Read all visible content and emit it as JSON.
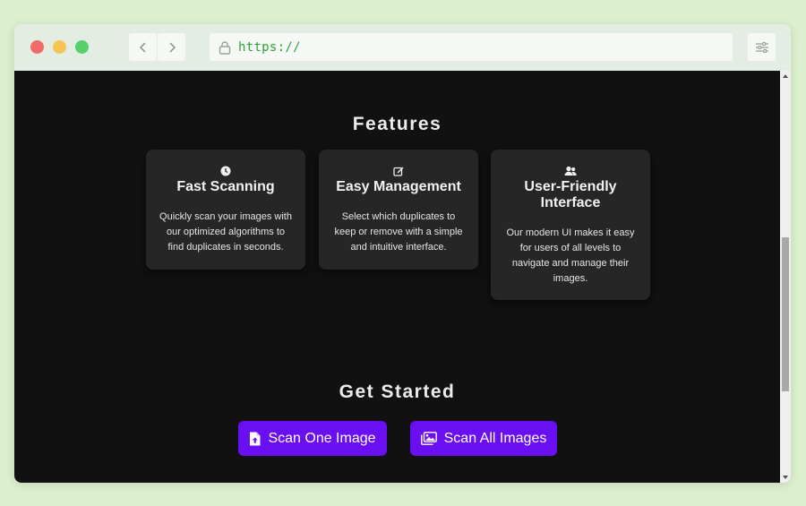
{
  "browser": {
    "url": "https://",
    "icons": [
      "back-chevron-icon",
      "forward-chevron-icon",
      "lock-icon",
      "sliders-icon"
    ]
  },
  "features": {
    "title": "Features",
    "cards": [
      {
        "icon": "clock-icon",
        "title": "Fast Scanning",
        "text": "Quickly scan your images with our optimized algorithms to find duplicates in seconds."
      },
      {
        "icon": "edit-icon",
        "title": "Easy Management",
        "text": "Select which duplicates to keep or remove with a simple and intuitive interface."
      },
      {
        "icon": "users-icon",
        "title": "User-Friendly Interface",
        "text": "Our modern UI makes it easy for users of all levels to navigate and manage their images."
      }
    ]
  },
  "get_started": {
    "title": "Get Started",
    "scan_one_label": "Scan One Image",
    "scan_all_label": "Scan All Images",
    "scan_one_icon": "file-upload-icon",
    "scan_all_icon": "images-icon"
  },
  "colors": {
    "page_background": "#dcefcf",
    "content_background": "#111111",
    "card_background": "#262626",
    "accent": "#6a0ff2",
    "url_text": "#2aa33a"
  }
}
